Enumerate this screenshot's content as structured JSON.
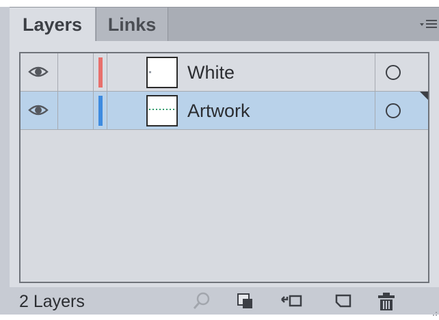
{
  "tabs": [
    {
      "label": "Layers",
      "active": true
    },
    {
      "label": "Links",
      "active": false
    }
  ],
  "panel_menu_icon": "panel-menu-icon",
  "layers": [
    {
      "name": "White",
      "color": "#e8706c",
      "selected": false,
      "visible": true
    },
    {
      "name": "Artwork",
      "color": "#3e8be0",
      "selected": true,
      "visible": true
    }
  ],
  "footer": {
    "count_label": "2 Layers",
    "buttons": [
      "search-icon",
      "collect-for-export-icon",
      "make-clipping-mask-icon",
      "new-sublayer-icon",
      "new-layer-icon",
      "trash-icon"
    ]
  },
  "colors": {
    "selected_row": "#b9d2ea",
    "panel_bg": "#dadde3"
  }
}
